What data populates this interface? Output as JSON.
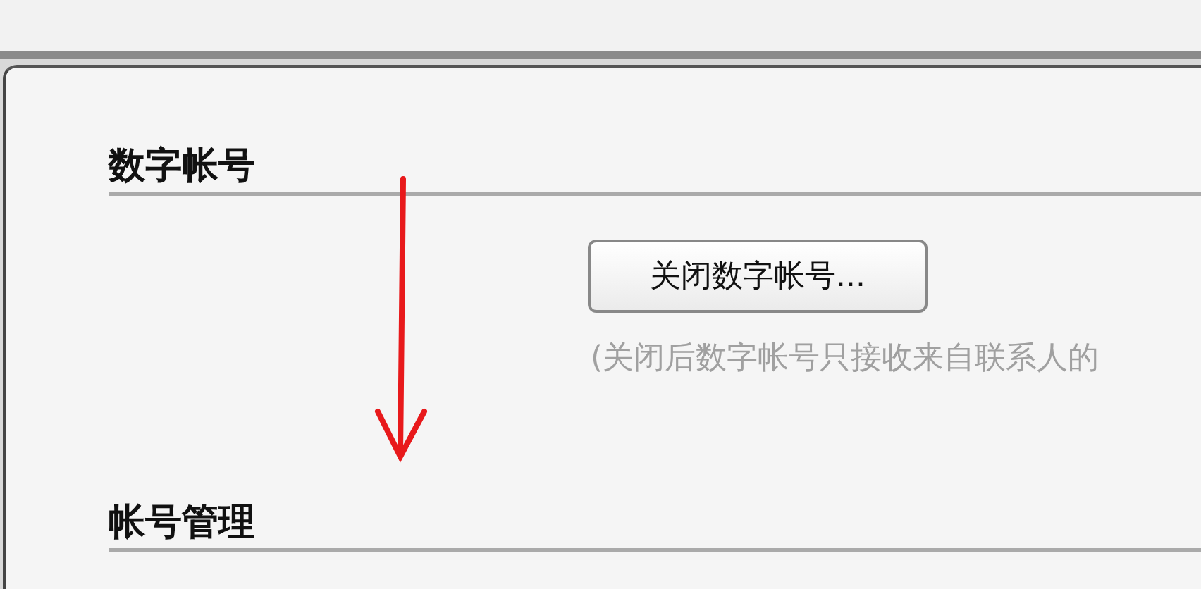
{
  "sections": [
    {
      "title": "数字帐号",
      "button": "关闭数字帐号...",
      "note": "(关闭后数字帐号只接收来自联系人的"
    },
    {
      "title": "帐号管理"
    }
  ]
}
